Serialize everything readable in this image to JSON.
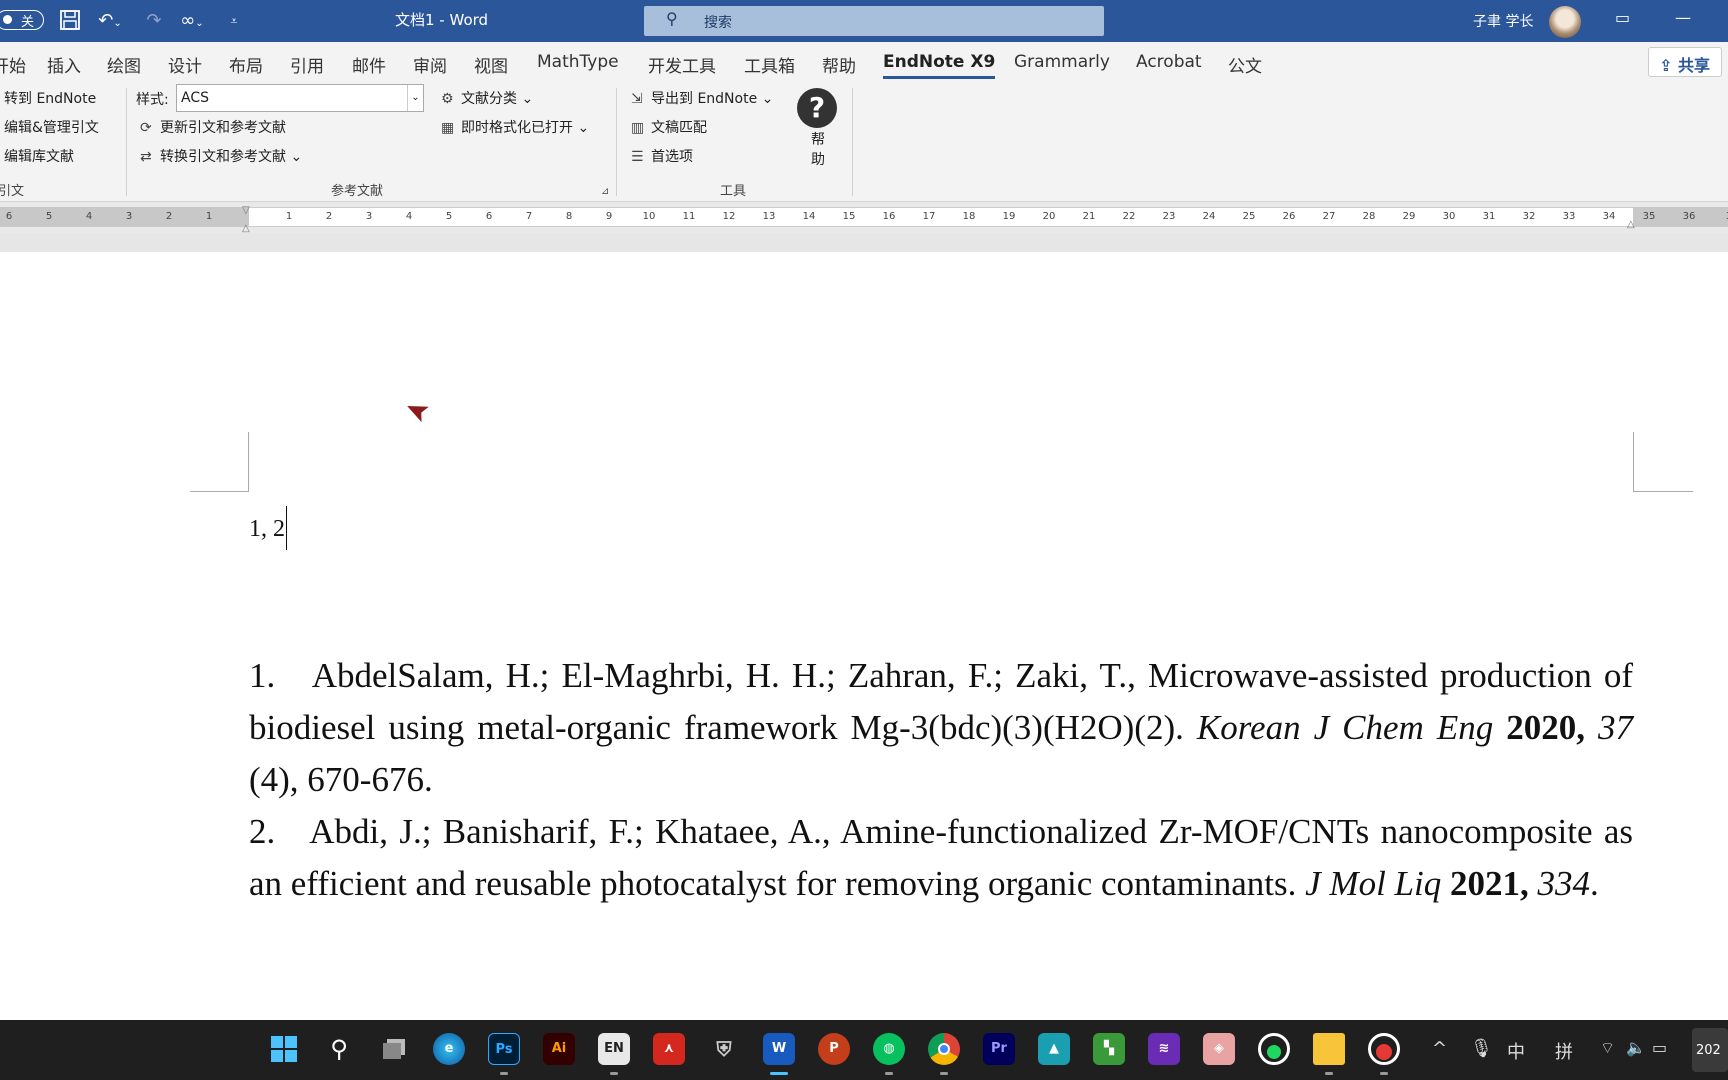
{
  "titlebar": {
    "autosave_toggle": "关",
    "doc_title": "文档1  -  Word",
    "search_placeholder": "搜索",
    "user_name": "子聿 学长",
    "accent": "#2b579a"
  },
  "tabs": {
    "items": [
      "开始",
      "插入",
      "绘图",
      "设计",
      "布局",
      "引用",
      "邮件",
      "审阅",
      "视图",
      "MathType",
      "开发工具",
      "工具箱",
      "帮助",
      "EndNote X9",
      "Grammarly",
      "Acrobat",
      "公文"
    ],
    "active": "EndNote X9",
    "share_label": "共享"
  },
  "ribbon": {
    "citations": {
      "go_to_endnote": "转到 EndNote",
      "edit_manage": "编辑&管理引文",
      "edit_library": "编辑库文献",
      "group_label": "引文"
    },
    "bibliography": {
      "style_label": "样式:",
      "style_value": "ACS",
      "update": "更新引文和参考文献",
      "convert": "转换引文和参考文献",
      "categorize": "文献分类",
      "instant_format": "即时格式化已打开",
      "group_label": "参考文献"
    },
    "tools": {
      "export": "导出到 EndNote",
      "manuscript_matcher": "文稿匹配",
      "preferences": "首选项",
      "help": "帮助",
      "group_label": "工具"
    }
  },
  "ruler": {
    "left_numbers": [
      "6",
      "5",
      "4",
      "3",
      "2",
      "1"
    ],
    "right_numbers": [
      "1",
      "2",
      "3",
      "4",
      "5",
      "6",
      "7",
      "8",
      "9",
      "10",
      "11",
      "12",
      "13",
      "14",
      "15",
      "16",
      "17",
      "18",
      "19",
      "20",
      "21",
      "22",
      "23",
      "24",
      "25",
      "26",
      "27",
      "28",
      "29",
      "30",
      "31",
      "32",
      "33",
      "34",
      "35",
      "36",
      "3"
    ]
  },
  "document": {
    "citation": "1, 2",
    "references": [
      {
        "number": "1.",
        "authors": "AbdelSalam, H.;   El-Maghrbi, H. H.;   Zahran, F.; Zaki, T., ",
        "title": "Microwave-assisted production of biodiesel using metal-organic framework Mg-3(bdc)(3)(H2O)(2). ",
        "journal": "Korean J Chem Eng",
        "year": "2020,",
        "volume": "37",
        "pages": " (4), 670-676."
      },
      {
        "number": "2.",
        "authors": "Abdi, J.;   Banisharif, F.; Khataee, A., ",
        "title": "Amine-functionalized Zr-MOF/CNTs nanocomposite as an efficient and reusable photocatalyst for removing organic contaminants. ",
        "journal": "J Mol Liq",
        "year": "2021,",
        "volume": "334",
        "pages": "."
      }
    ]
  },
  "taskbar": {
    "apps": [
      "windows-start",
      "search",
      "task-view",
      "edge",
      "photoshop",
      "illustrator",
      "endnote",
      "acrobat",
      "game",
      "word",
      "powerpoint",
      "wechat",
      "chrome",
      "premiere",
      "app-blue",
      "app-green",
      "app-purple",
      "app-pink",
      "app-green-circle",
      "file-explorer",
      "recorder"
    ],
    "tray_ime_lang": "中",
    "tray_ime_mode": "拼",
    "clock_partial": "202"
  }
}
